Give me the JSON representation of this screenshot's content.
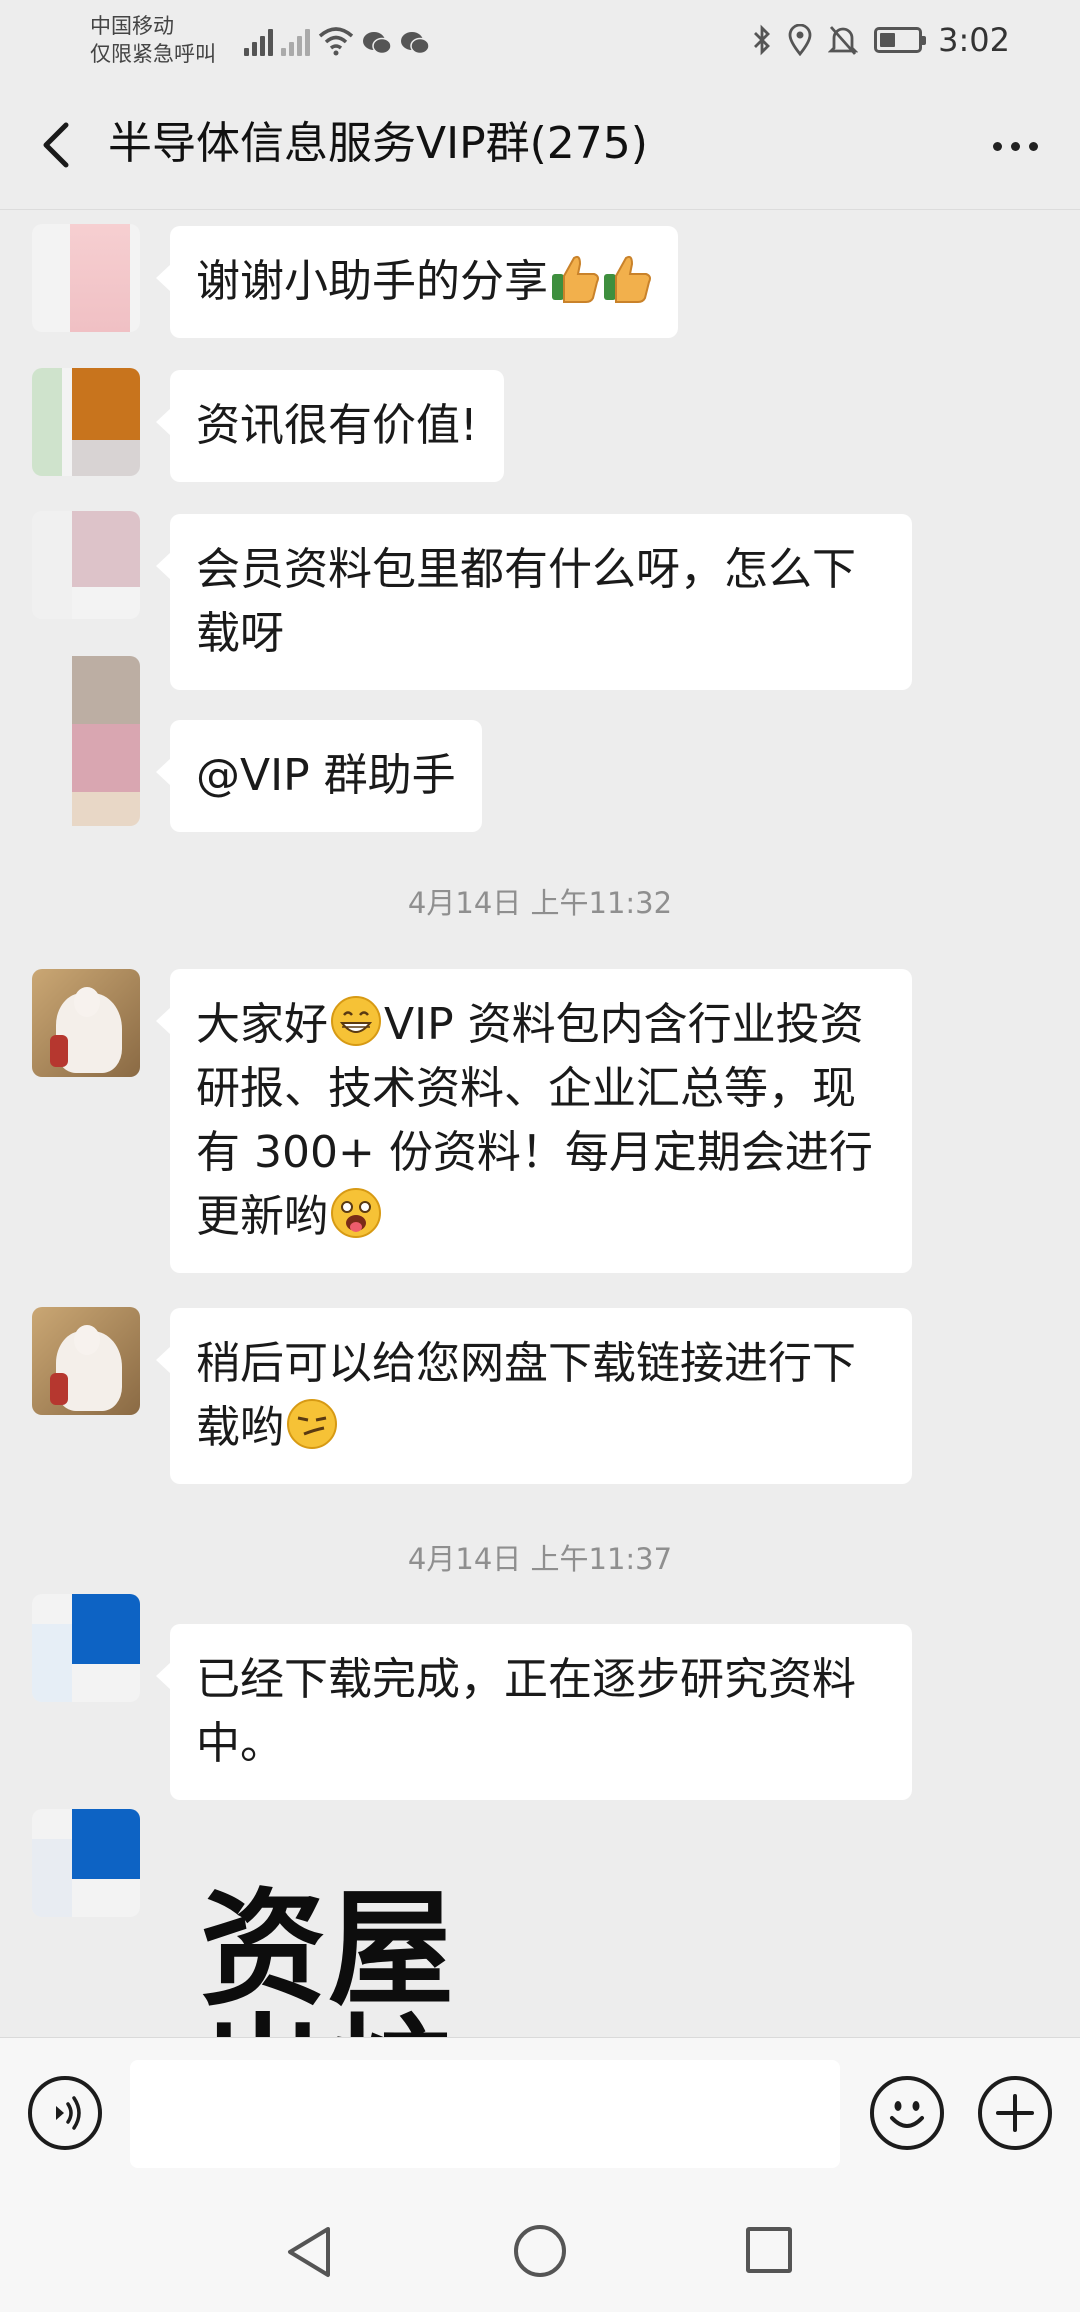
{
  "status_bar": {
    "carrier_line1": "中国移动",
    "carrier_line2": "仅限紧急呼叫",
    "time": "3:02",
    "icons": [
      "signal-icon",
      "no-sim-signal-icon",
      "wifi-icon",
      "wechat-icon",
      "wechat-icon",
      "bluetooth-icon",
      "location-icon",
      "mute-icon",
      "battery-icon"
    ]
  },
  "header": {
    "title": "半导体信息服务VIP群(275)",
    "back_icon": "chevron-left-icon",
    "more_icon": "more-dots-icon"
  },
  "messages": [
    {
      "text": "谢谢小助手的分享",
      "emoji": [
        "thumbs-up-icon",
        "thumbs-up-icon"
      ]
    },
    {
      "text": "资讯很有价值!"
    },
    {
      "text": "会员资料包里都有什么呀，怎么下载呀"
    },
    {
      "text": "@VIP 群助手"
    }
  ],
  "timestamp_1": "4月14日 上午11:32",
  "assistant_messages": [
    {
      "text_before": "大家好",
      "text_after": "VIP 资料包内含行业投资研报、技术资料、企业汇总等，现有 300+ 份资料！每月定期会进行更新哟",
      "emoji": [
        "grin-icon",
        "star-struck-icon"
      ]
    },
    {
      "text": "稍后可以给您网盘下载链接进行下载哟",
      "emoji": [
        "smirk-icon"
      ]
    }
  ],
  "timestamp_2": "4月14日 上午11:37",
  "late_messages": [
    {
      "text": "已经下载完成，正在逐步研究资料中。"
    }
  ],
  "image_message": {
    "line1": "资屋",
    "line2": "出炉"
  },
  "colors": {
    "background": "#ededed",
    "bubble": "#ffffff",
    "timestamp": "#8f8f8f"
  }
}
